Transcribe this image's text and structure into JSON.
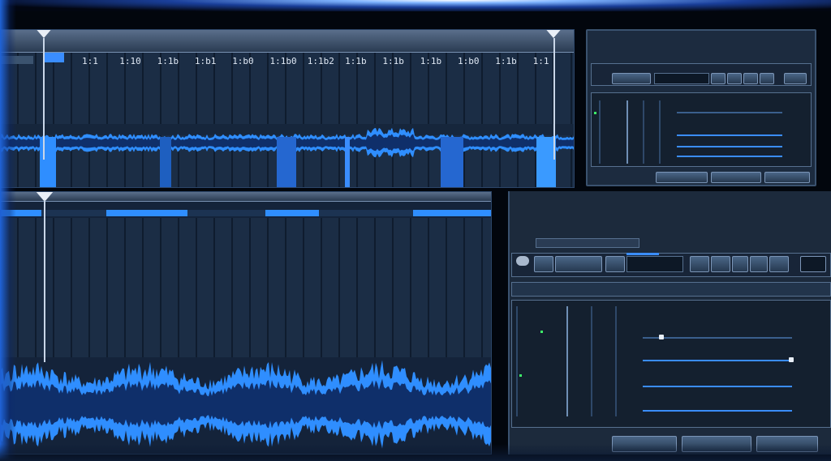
{
  "timeline": {
    "ticks": [
      "1:1",
      "1:10",
      "1:1b",
      "1:b1",
      "1:b0",
      "1:1b0",
      "1:1b2",
      "1:1b",
      "1:1b",
      "1:1b",
      "1:b0",
      "1:1b",
      "1:1"
    ]
  },
  "top_right_panel": {
    "header_label": "",
    "control_labels": [
      "",
      "",
      ""
    ],
    "buttons": [
      "",
      "",
      ""
    ]
  },
  "bottom_right_panel": {
    "header_text": "",
    "buttons": [
      "",
      "",
      ""
    ]
  },
  "colors": {
    "accent": "#3a8dff",
    "waveform": "#2f8eff",
    "waveform_dark": "#0f2f6a",
    "led": "#3ef06a",
    "label_yellow": "#e8c84a"
  }
}
